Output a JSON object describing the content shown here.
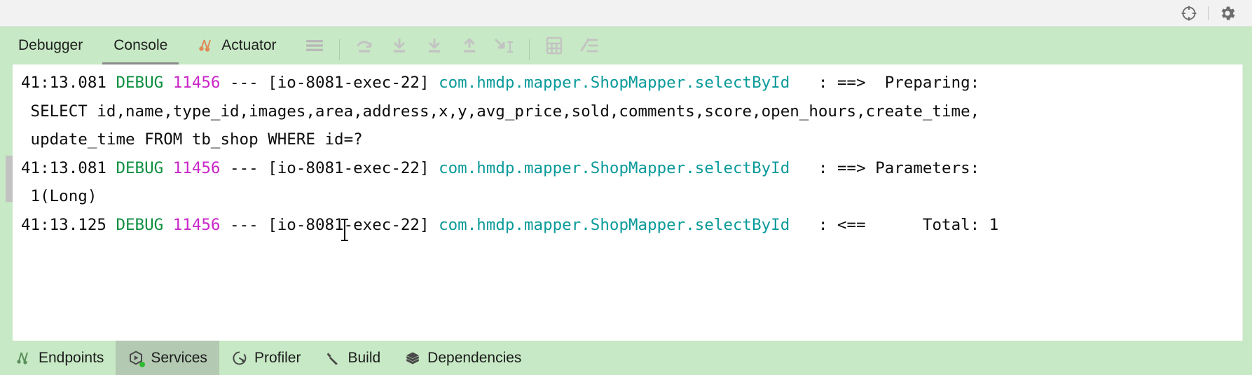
{
  "topbar": {
    "icons": [
      {
        "name": "target-icon",
        "label": "Find Current Element"
      },
      {
        "name": "gear-icon",
        "label": "Settings"
      }
    ]
  },
  "tabs": [
    {
      "id": "debugger",
      "label": "Debugger",
      "icon": null,
      "active": false
    },
    {
      "id": "console",
      "label": "Console",
      "icon": null,
      "active": true
    },
    {
      "id": "actuator",
      "label": "Actuator",
      "icon": "actuator-icon",
      "active": false
    }
  ],
  "toolbar": {
    "buttons": [
      {
        "id": "hamburger",
        "icon": "menu-icon",
        "enabled": true
      },
      {
        "id": "step-over",
        "icon": "step-over-icon",
        "enabled": false
      },
      {
        "id": "step-into",
        "icon": "step-into-icon",
        "enabled": false
      },
      {
        "id": "force-step-into",
        "icon": "force-step-into-icon",
        "enabled": false
      },
      {
        "id": "step-out",
        "icon": "step-out-icon",
        "enabled": false
      },
      {
        "id": "run-to-cursor",
        "icon": "run-to-cursor-icon",
        "enabled": false
      },
      {
        "id": "evaluate-expression",
        "icon": "calculator-icon",
        "enabled": false
      },
      {
        "id": "soft-wrap",
        "icon": "soft-wrap-icon",
        "enabled": false
      }
    ]
  },
  "console": {
    "lines": [
      {
        "id": "line-1",
        "segments": [
          {
            "cls": "c-ts",
            "text": "41:13.081 "
          },
          {
            "cls": "c-lvl",
            "text": "DEBUG"
          },
          {
            "cls": "c-ts",
            "text": " "
          },
          {
            "cls": "c-pid",
            "text": "11456"
          },
          {
            "cls": "c-dash",
            "text": " --- "
          },
          {
            "cls": "c-thr",
            "text": "[io-8081-exec-22] "
          },
          {
            "cls": "c-cls",
            "text": "com.hmdp.mapper.ShopMapper.selectById"
          },
          {
            "cls": "c-msg",
            "text": "   : ==>  Preparing:"
          }
        ]
      },
      {
        "id": "line-2",
        "segments": [
          {
            "cls": "c-msg",
            "text": " SELECT id,name,type_id,images,area,address,x,y,avg_price,sold,comments,score,open_hours,create_time,"
          }
        ]
      },
      {
        "id": "line-3",
        "segments": [
          {
            "cls": "c-msg",
            "text": " update_time FROM tb_shop WHERE id=?"
          }
        ]
      },
      {
        "id": "line-4",
        "segments": [
          {
            "cls": "c-ts",
            "text": "41:13.081 "
          },
          {
            "cls": "c-lvl",
            "text": "DEBUG"
          },
          {
            "cls": "c-ts",
            "text": " "
          },
          {
            "cls": "c-pid",
            "text": "11456"
          },
          {
            "cls": "c-dash",
            "text": " --- "
          },
          {
            "cls": "c-thr",
            "text": "[io-8081-exec-22] "
          },
          {
            "cls": "c-cls",
            "text": "com.hmdp.mapper.ShopMapper.selectById"
          },
          {
            "cls": "c-msg",
            "text": "   : ==> Parameters:"
          }
        ]
      },
      {
        "id": "line-5",
        "segments": [
          {
            "cls": "c-msg",
            "text": " 1(Long)"
          }
        ]
      },
      {
        "id": "line-6",
        "segments": [
          {
            "cls": "c-ts",
            "text": "41:13.125 "
          },
          {
            "cls": "c-lvl",
            "text": "DEBUG"
          },
          {
            "cls": "c-ts",
            "text": " "
          },
          {
            "cls": "c-pid",
            "text": "11456"
          },
          {
            "cls": "c-dash",
            "text": " --- "
          },
          {
            "cls": "c-thr",
            "text": "[io-8081-exec-22] "
          },
          {
            "cls": "c-cls",
            "text": "com.hmdp.mapper.ShopMapper.selectById"
          },
          {
            "cls": "c-msg",
            "text": "   : <==      Total: 1"
          }
        ]
      }
    ]
  },
  "bottombar": {
    "items": [
      {
        "id": "endpoints",
        "label": "Endpoints",
        "icon": "endpoints-icon",
        "selected": false,
        "running": false
      },
      {
        "id": "services",
        "label": "Services",
        "icon": "services-icon",
        "selected": true,
        "running": true
      },
      {
        "id": "profiler",
        "label": "Profiler",
        "icon": "profiler-icon",
        "selected": false,
        "running": false
      },
      {
        "id": "build",
        "label": "Build",
        "icon": "build-icon",
        "selected": false,
        "running": false
      },
      {
        "id": "dependencies",
        "label": "Dependencies",
        "icon": "dependencies-icon",
        "selected": false,
        "running": false
      }
    ]
  },
  "colors": {
    "toolwindow_green": "#c7e9c5",
    "selected_tab": "#b3c9b2",
    "log_level": "#0c8f3f",
    "log_pid": "#c926c9",
    "log_class": "#0a9a9a",
    "run_indicator": "#2fbb2f"
  }
}
